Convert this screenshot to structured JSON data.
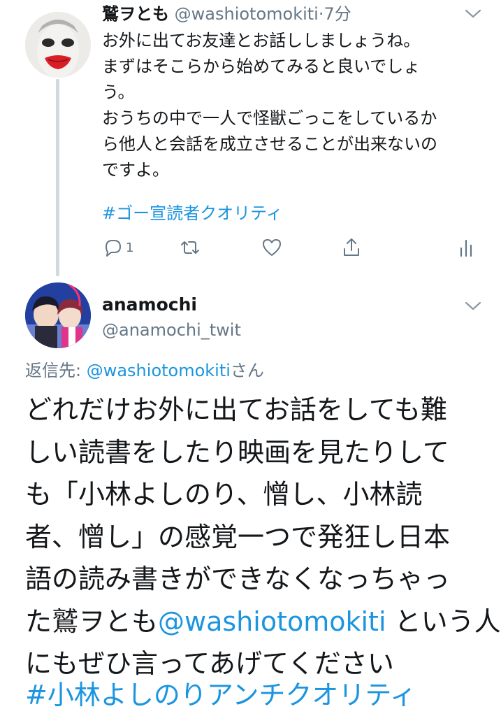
{
  "parent_tweet": {
    "display_name": "鷲ヲとも",
    "handle": "@washiotomokiti",
    "separator": "·",
    "time": "7分",
    "text_lines": [
      "お外に出てお友達とお話ししましょうね。",
      "まずはそこらから始めてみると良いでしょ",
      "う。",
      "おうちの中で一人で怪獣ごっこをしているか",
      "ら他人と会話を成立させることが出来ないの",
      "ですよ。"
    ],
    "hashtag": "#ゴー宣読者クオリティ",
    "reply_count": "1",
    "icons": {
      "reply": "reply-icon",
      "retweet": "retweet-icon",
      "like": "heart-icon",
      "share": "share-icon",
      "analytics": "analytics-icon",
      "menu": "chevron-down-icon"
    }
  },
  "reply_tweet": {
    "display_name": "anamochi",
    "handle": "@anamochi_twit",
    "reply_to_prefix": "返信先: ",
    "reply_to_handle": "@washiotomokiti",
    "reply_to_suffix": "さん",
    "text_lines": [
      "どれだけお外に出てお話をしても難",
      "しい読書をしたり映画を見たりして",
      "も「小林よしのり、憎し、小林読",
      "者、憎し」の感覚一つで発狂し日本",
      "語の読み書きができなくなっちゃっ"
    ],
    "line6_prefix": "た鷲ヲとも",
    "line6_mention": "@washiotomokiti",
    "line6_suffix": " という人",
    "line7": "にもぜひ言ってあげてください",
    "hashtag": "#小林よしのりアンチクオリティ"
  },
  "colors": {
    "link": "#1b95e0",
    "secondary_text": "#657786",
    "thread_line": "#cfd9de"
  }
}
